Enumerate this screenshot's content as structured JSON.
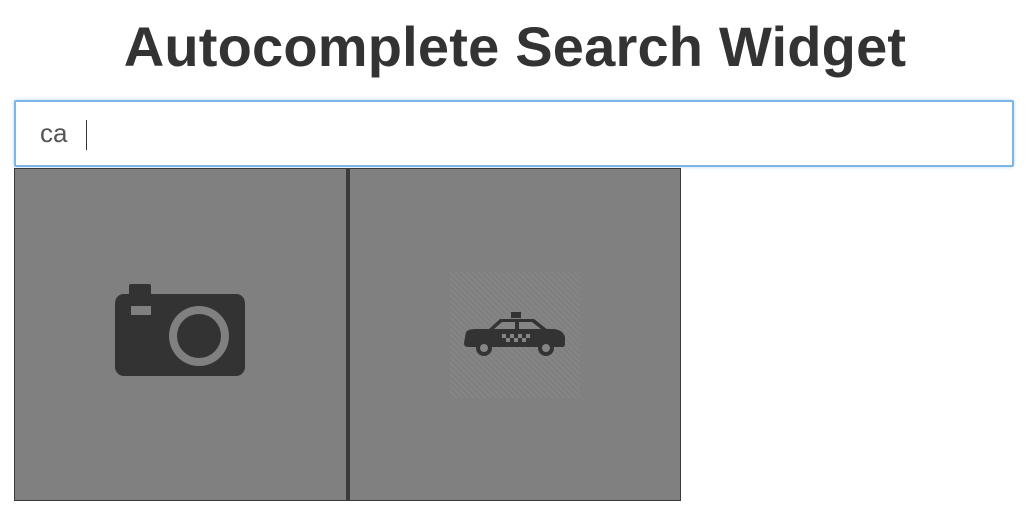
{
  "page": {
    "title": "Autocomplete Search Widget"
  },
  "search": {
    "value": "ca",
    "placeholder": ""
  },
  "results": [
    {
      "icon": "camera-icon"
    },
    {
      "icon": "taxi-icon"
    }
  ],
  "colors": {
    "title": "#333333",
    "input_border": "#7cb6e6",
    "tile_background": "#808080",
    "tile_border": "#3a3a3a",
    "icon": "#333333"
  }
}
